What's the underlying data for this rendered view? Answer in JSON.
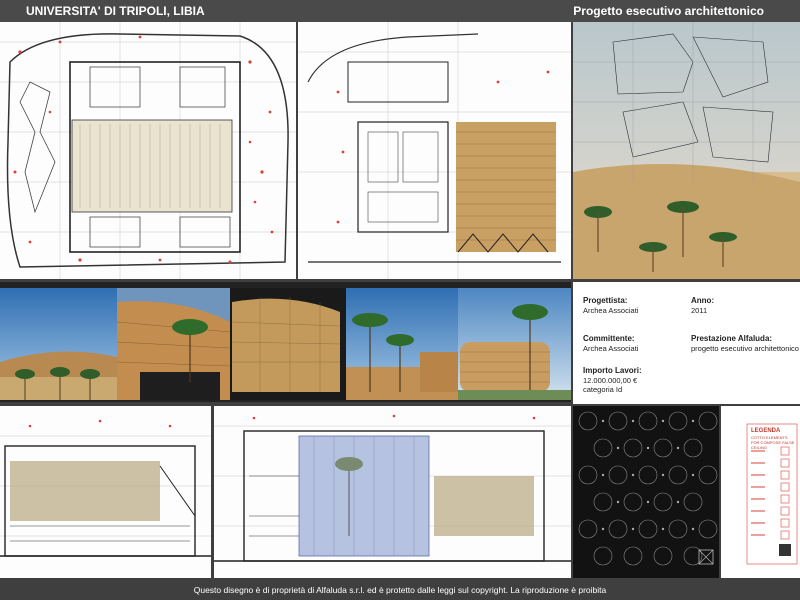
{
  "header": {
    "title": "UNIVERSITA' DI TRIPOLI, LIBIA",
    "subtitle": "Progetto esecutivo architettonico"
  },
  "info": {
    "progettista_label": "Progettista:",
    "progettista_value": "Archea Associati",
    "anno_label": "Anno:",
    "anno_value": "2011",
    "committente_label": "Committente:",
    "committente_value": "Archea Associati",
    "prestazione_label": "Prestazione Alfaluda:",
    "prestazione_value": "progetto esecutivo architettonico",
    "importo_label": "Importo Lavori:",
    "importo_value": "12.000.000,00 €",
    "categoria_value": "categoria Id"
  },
  "legend": {
    "title": "LEGENDA",
    "subtitle": "COTTO ELEMENTS FOR COMPOSE FALSE CEILING"
  },
  "footer": {
    "text": "Questo disegno è di proprietà di Alfaluda s.r.l. ed è protetto dalle leggi sul copyright. La riproduzione è proibita"
  },
  "colors": {
    "background": "#3f3f3f",
    "header": "#4a4a4a",
    "redline": "#d8413a",
    "terracotta": "#c9964f"
  }
}
